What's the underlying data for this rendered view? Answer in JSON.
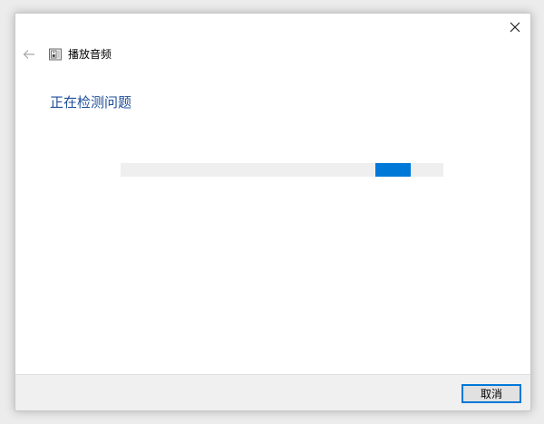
{
  "window": {
    "title": "播放音频",
    "close_icon": "close-icon",
    "back_icon": "back-arrow-icon",
    "app_icon": "speaker-icon"
  },
  "main": {
    "heading": "正在检测问题",
    "progress": {
      "type": "marquee",
      "chunk_start_fraction": 0.79,
      "chunk_width_fraction": 0.11
    }
  },
  "footer": {
    "cancel_label": "取消"
  },
  "colors": {
    "heading": "#1e4e9a",
    "accent": "#0078d7",
    "track": "#efefef",
    "footer_bg": "#f0f0f0"
  }
}
